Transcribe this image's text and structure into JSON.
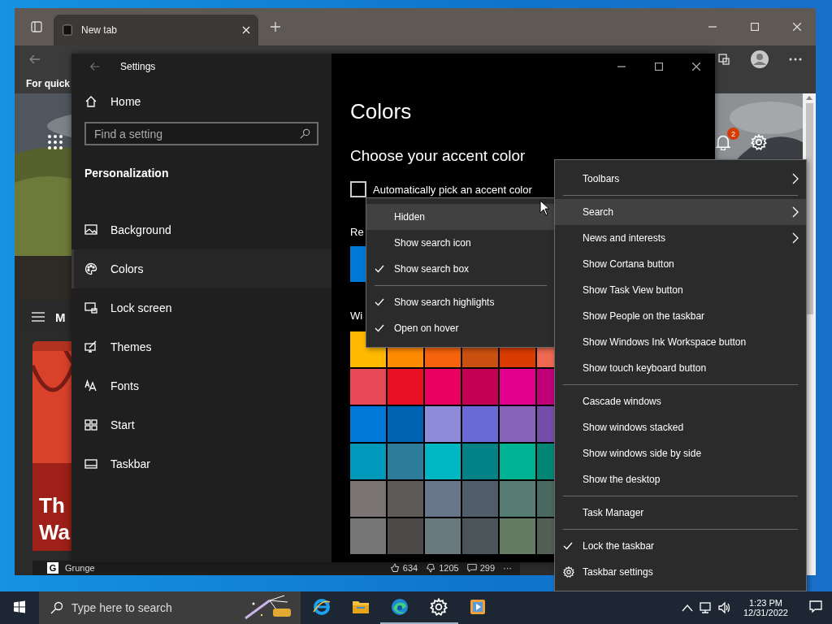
{
  "browser": {
    "tabs": [
      {
        "label": "New tab",
        "selected": true
      }
    ],
    "favorites_bar": {
      "text": "For quick"
    },
    "notifications": {
      "badge": "2"
    },
    "feed_nav": {
      "label": "M"
    },
    "card": {
      "headline_lines": [
        "Th",
        "Wa"
      ],
      "publisher_logo": "G",
      "publisher": "Grunge",
      "likes": "634",
      "dislikes": "1205",
      "comments": "299",
      "more": "···"
    }
  },
  "settings": {
    "title": "Settings",
    "home": "Home",
    "search": {
      "placeholder": "Find a setting"
    },
    "section": "Personalization",
    "nav": [
      {
        "label": "Background",
        "selected": false
      },
      {
        "label": "Colors",
        "selected": true
      },
      {
        "label": "Lock screen",
        "selected": false
      },
      {
        "label": "Themes",
        "selected": false
      },
      {
        "label": "Fonts",
        "selected": false
      },
      {
        "label": "Start",
        "selected": false
      },
      {
        "label": "Taskbar",
        "selected": false
      }
    ],
    "page_title": "Colors",
    "heading": "Choose your accent color",
    "auto_pick": {
      "label": "Automatically pick an accent color",
      "checked": false
    },
    "recent_label": "Re",
    "recent_colors": [
      {
        "color": "#0078d7"
      }
    ],
    "windows_label": "Wi",
    "accent_grid": [
      [
        {
          "color": "#ffb900"
        },
        {
          "color": "#ff8c00"
        },
        {
          "color": "#f7630c"
        },
        {
          "color": "#ca5010"
        },
        {
          "color": "#da3b01"
        },
        {
          "color": "#ef6950"
        }
      ],
      [
        {
          "color": "#e74856"
        },
        {
          "color": "#e81123"
        },
        {
          "color": "#ea005e"
        },
        {
          "color": "#c30052"
        },
        {
          "color": "#e3008c"
        },
        {
          "color": "#bf0077"
        }
      ],
      [
        {
          "color": "#0078d7"
        },
        {
          "color": "#0063b1"
        },
        {
          "color": "#8e8cd8"
        },
        {
          "color": "#6b69d6"
        },
        {
          "color": "#8764b8"
        },
        {
          "color": "#744da9"
        }
      ],
      [
        {
          "color": "#0099bc"
        },
        {
          "color": "#2d7d9a"
        },
        {
          "color": "#00b7c3"
        },
        {
          "color": "#038387"
        },
        {
          "color": "#00b294"
        },
        {
          "color": "#018574"
        }
      ],
      [
        {
          "color": "#7a7574"
        },
        {
          "color": "#5d5a58"
        },
        {
          "color": "#68768a"
        },
        {
          "color": "#515c6b"
        },
        {
          "color": "#567c73"
        },
        {
          "color": "#486860"
        }
      ],
      [
        {
          "color": "#767676"
        },
        {
          "color": "#4c4a48"
        },
        {
          "color": "#69797e"
        },
        {
          "color": "#4a5459"
        },
        {
          "color": "#647c64"
        },
        {
          "color": "#525e54"
        }
      ]
    ]
  },
  "search_submenu": [
    {
      "kind": "option",
      "label": "Hidden",
      "checked": false,
      "selected": true
    },
    {
      "kind": "option",
      "label": "Show search icon",
      "checked": false,
      "selected": false
    },
    {
      "kind": "option",
      "label": "Show search box",
      "checked": true,
      "selected": false
    },
    {
      "kind": "separator"
    },
    {
      "kind": "option",
      "label": "Show search highlights",
      "checked": true,
      "selected": false
    },
    {
      "kind": "option",
      "label": "Open on hover",
      "checked": true,
      "selected": false
    }
  ],
  "context_menu": [
    {
      "kind": "submenu",
      "label": "Toolbars",
      "selected": false
    },
    {
      "kind": "separator"
    },
    {
      "kind": "submenu",
      "label": "Search",
      "selected": true
    },
    {
      "kind": "submenu",
      "label": "News and interests",
      "selected": false
    },
    {
      "kind": "toggle",
      "label": "Show Cortana button",
      "checked": false,
      "selected": false
    },
    {
      "kind": "toggle",
      "label": "Show Task View button",
      "checked": false,
      "selected": false
    },
    {
      "kind": "toggle",
      "label": "Show People on the taskbar",
      "checked": false,
      "selected": false
    },
    {
      "kind": "toggle",
      "label": "Show Windows Ink Workspace button",
      "checked": false,
      "selected": false
    },
    {
      "kind": "toggle",
      "label": "Show touch keyboard button",
      "checked": false,
      "selected": false
    },
    {
      "kind": "separator"
    },
    {
      "kind": "command",
      "label": "Cascade windows",
      "selected": false
    },
    {
      "kind": "command",
      "label": "Show windows stacked",
      "selected": false
    },
    {
      "kind": "command",
      "label": "Show windows side by side",
      "selected": false
    },
    {
      "kind": "command",
      "label": "Show the desktop",
      "selected": false
    },
    {
      "kind": "separator"
    },
    {
      "kind": "command",
      "label": "Task Manager",
      "selected": false
    },
    {
      "kind": "separator"
    },
    {
      "kind": "toggle",
      "label": "Lock the taskbar",
      "checked": true,
      "selected": false
    },
    {
      "kind": "settings",
      "label": "Taskbar settings",
      "selected": false
    }
  ],
  "taskbar": {
    "search": {
      "placeholder": "Type here to search"
    },
    "apps": [
      {
        "kind": "ie",
        "open": false
      },
      {
        "kind": "explorer",
        "open": false
      },
      {
        "kind": "edge",
        "open": true
      },
      {
        "kind": "settings",
        "open": true
      },
      {
        "kind": "media",
        "open": false
      }
    ],
    "time": "1:23 PM",
    "date": "12/31/2022"
  }
}
